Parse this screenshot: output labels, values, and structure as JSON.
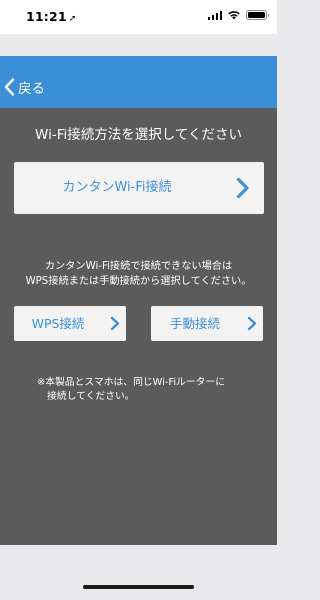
{
  "status_bar": {
    "time": "11:21",
    "location_glyph": "➚",
    "signal_icon": "cellular-signal-icon",
    "wifi_icon": "wifi-icon",
    "battery_icon": "battery-icon",
    "battery_level": 1.0
  },
  "header": {
    "back_label": "戻る",
    "back_icon": "chevron-left-icon",
    "background_color": "#3b8fd6"
  },
  "main": {
    "title": "Wi-Fi接続方法を選択してください",
    "easy_button_label": "カンタンWi-Fi接続",
    "note_line1": "カンタンWi-Fi接続で接続できない場合は",
    "note_line2": "WPS接続または手動接続から選択してください。",
    "wps_button_label": "WPS接続",
    "manual_button_label": "手動接続",
    "footnote_line1": "※本製品とスマホは、同じWi-Fiルーターに",
    "footnote_line2": "接続してください。",
    "accent_color": "#3d8fd8",
    "panel_color": "#5b5b5b"
  }
}
